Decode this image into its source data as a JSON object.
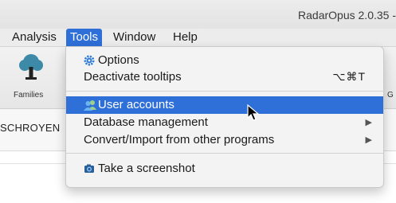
{
  "window": {
    "title": "RadarOpus 2.0.35 -"
  },
  "menubar": {
    "items": [
      {
        "label": "Analysis"
      },
      {
        "label": "Tools"
      },
      {
        "label": "Window"
      },
      {
        "label": "Help"
      }
    ]
  },
  "toolbar": {
    "families_label": "Families",
    "g_label": "G"
  },
  "tabs": {
    "label": "SCHROYEN"
  },
  "tools_menu": {
    "options_label": "Options",
    "deactivate_tooltips_label": "Deactivate tooltips",
    "deactivate_tooltips_shortcut": "⌥⌘T",
    "user_accounts_label": "User accounts",
    "database_management_label": "Database management",
    "convert_import_label": "Convert/Import from other programs",
    "take_screenshot_label": "Take a screenshot",
    "submenu_arrow": "▶"
  },
  "icons": {
    "options": "gear-icon",
    "user_accounts": "users-icon",
    "screenshot": "camera-icon",
    "families": "tree-icon"
  },
  "colors": {
    "highlight": "#2f6fd8",
    "menu_background": "#f3f3f3"
  }
}
